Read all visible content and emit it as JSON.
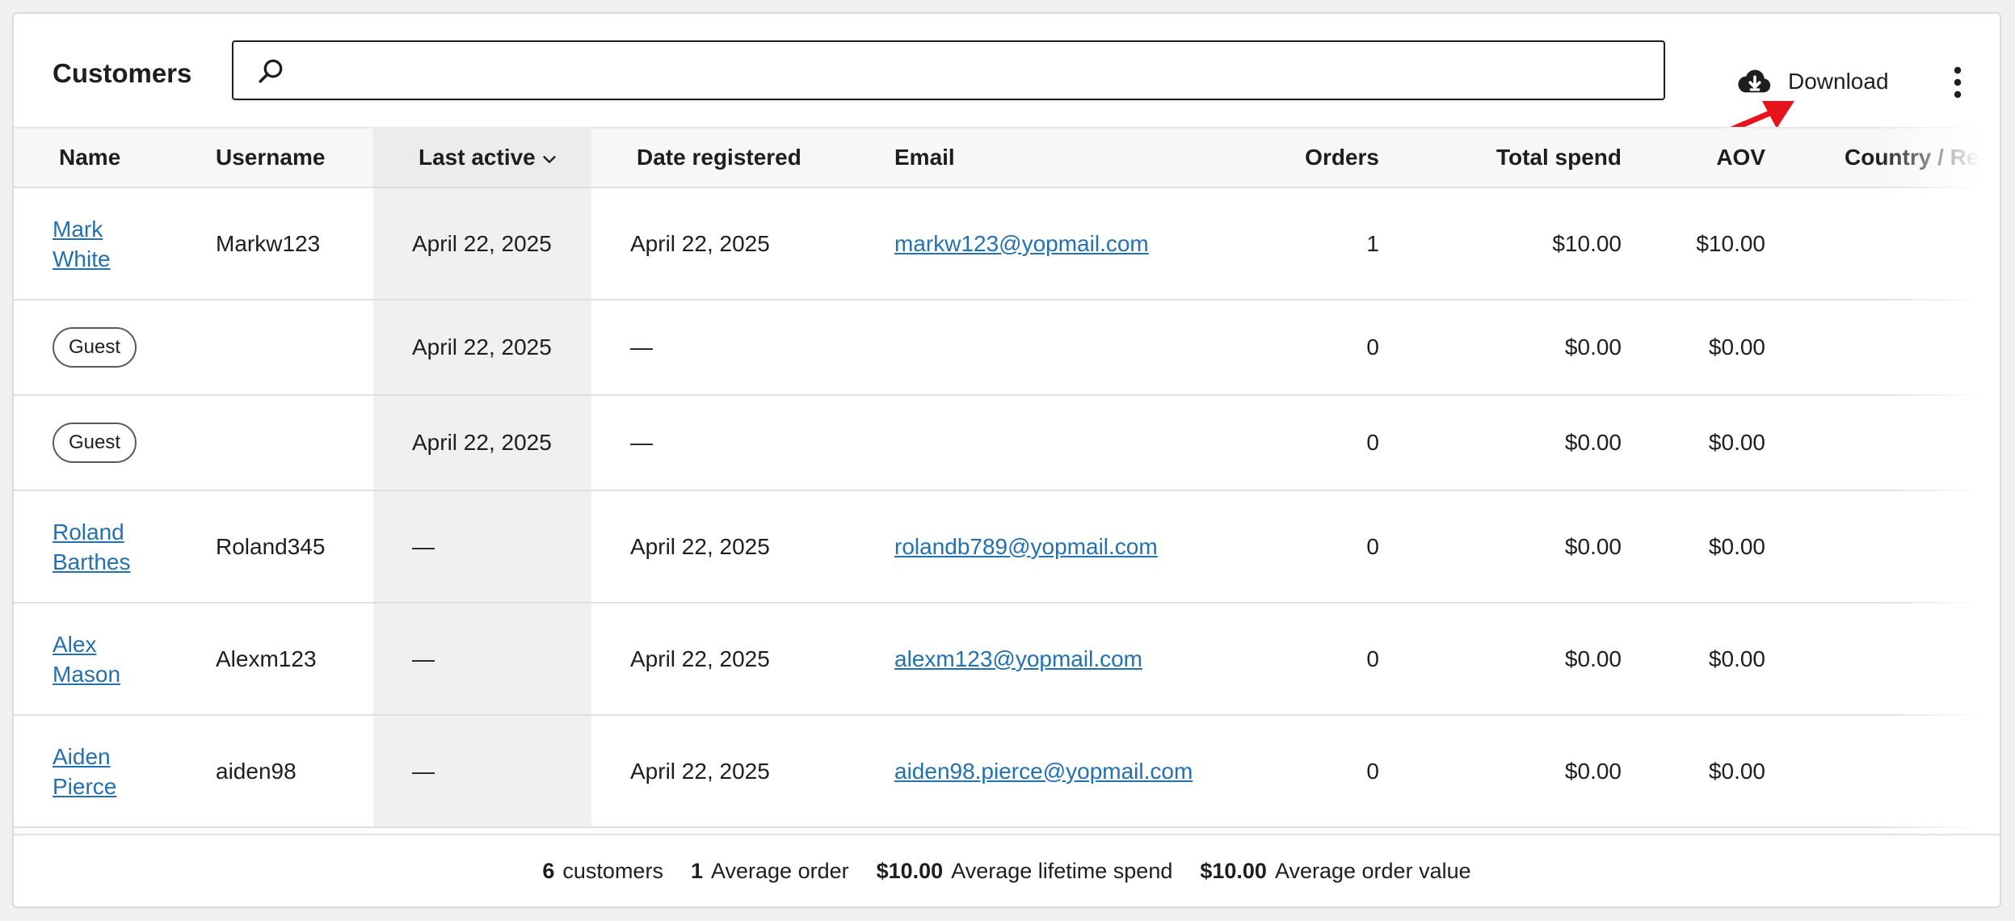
{
  "header": {
    "title": "Customers",
    "search_value": "",
    "download_label": "Download"
  },
  "table": {
    "columns": [
      "Name",
      "Username",
      "Last active",
      "Date registered",
      "Email",
      "Orders",
      "Total spend",
      "AOV",
      "Country / Region"
    ],
    "sorted_column": "Last active",
    "rows": [
      {
        "name": "Mark White",
        "name_line1": "Mark",
        "name_line2": "White",
        "guest": false,
        "username": "Markw123",
        "last_active": "April 22, 2025",
        "date_registered": "April 22, 2025",
        "email": "markw123@yopmail.com",
        "orders": "1",
        "total_spend": "$10.00",
        "aov": "$10.00",
        "country": ""
      },
      {
        "name": "Guest",
        "guest": true,
        "username": "",
        "last_active": "April 22, 2025",
        "date_registered": "—",
        "email": "",
        "orders": "0",
        "total_spend": "$0.00",
        "aov": "$0.00",
        "country": ""
      },
      {
        "name": "Guest",
        "guest": true,
        "username": "",
        "last_active": "April 22, 2025",
        "date_registered": "—",
        "email": "",
        "orders": "0",
        "total_spend": "$0.00",
        "aov": "$0.00",
        "country": ""
      },
      {
        "name": "Roland Barthes",
        "name_line1": "Roland",
        "name_line2": "Barthes",
        "guest": false,
        "username": "Roland345",
        "last_active": "—",
        "date_registered": "April 22, 2025",
        "email": "rolandb789@yopmail.com",
        "orders": "0",
        "total_spend": "$0.00",
        "aov": "$0.00",
        "country": ""
      },
      {
        "name": "Alex Mason",
        "name_line1": "Alex",
        "name_line2": "Mason",
        "guest": false,
        "username": "Alexm123",
        "last_active": "—",
        "date_registered": "April 22, 2025",
        "email": "alexm123@yopmail.com",
        "orders": "0",
        "total_spend": "$0.00",
        "aov": "$0.00",
        "country": ""
      },
      {
        "name": "Aiden Pierce",
        "name_line1": "Aiden",
        "name_line2": "Pierce",
        "guest": false,
        "username": "aiden98",
        "last_active": "—",
        "date_registered": "April 22, 2025",
        "email": "aiden98.pierce@yopmail.com",
        "orders": "0",
        "total_spend": "$0.00",
        "aov": "$0.00",
        "country": ""
      }
    ]
  },
  "summary": [
    {
      "value": "6",
      "label": "customers"
    },
    {
      "value": "1",
      "label": "Average order"
    },
    {
      "value": "$10.00",
      "label": "Average lifetime spend"
    },
    {
      "value": "$10.00",
      "label": "Average order value"
    }
  ],
  "colors": {
    "link": "#2271b1",
    "annotation_arrow": "#e8141b"
  },
  "icons": [
    "search-icon",
    "cloud-download-icon",
    "more-vertical-icon",
    "chevron-down-icon"
  ]
}
